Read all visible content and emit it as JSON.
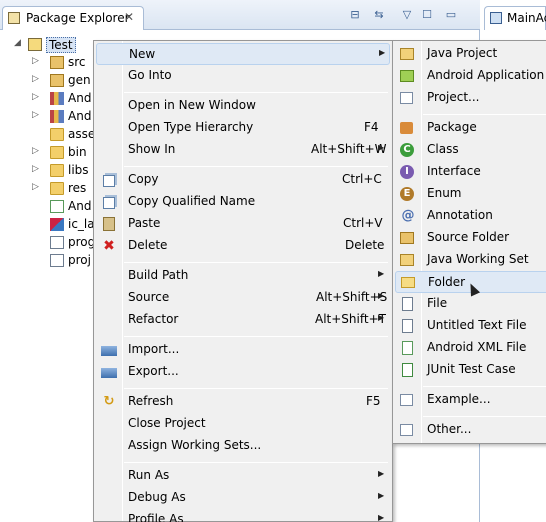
{
  "view": {
    "tab_title": "Package Explorer",
    "tab_close": "✕",
    "tools": [
      "⊟",
      "⇆",
      "▽",
      "☐"
    ],
    "editor_tab_title": "MainAc"
  },
  "tree": {
    "project": "Test",
    "items": [
      {
        "label": "src"
      },
      {
        "label": "gen"
      },
      {
        "label": "And"
      },
      {
        "label": "And"
      },
      {
        "label": "asse"
      },
      {
        "label": "bin"
      },
      {
        "label": "libs"
      },
      {
        "label": "res"
      },
      {
        "label": "And"
      },
      {
        "label": "ic_la"
      },
      {
        "label": "prog"
      },
      {
        "label": "proj"
      }
    ]
  },
  "context_menu": {
    "items": [
      {
        "label": "New",
        "accel": "",
        "submenu": true,
        "icon": ""
      },
      {
        "label": "Go Into",
        "accel": "",
        "submenu": false,
        "icon": ""
      },
      {
        "label": "Open in New Window",
        "accel": "",
        "submenu": false,
        "icon": ""
      },
      {
        "label": "Open Type Hierarchy",
        "accel": "F4",
        "submenu": false,
        "icon": ""
      },
      {
        "label": "Show In",
        "accel": "Alt+Shift+W",
        "submenu": true,
        "icon": ""
      },
      {
        "label": "Copy",
        "accel": "Ctrl+C",
        "submenu": false,
        "icon": "copy-icon"
      },
      {
        "label": "Copy Qualified Name",
        "accel": "",
        "submenu": false,
        "icon": "copy-icon"
      },
      {
        "label": "Paste",
        "accel": "Ctrl+V",
        "submenu": false,
        "icon": "paste-icon"
      },
      {
        "label": "Delete",
        "accel": "Delete",
        "submenu": false,
        "icon": "delete-icon"
      },
      {
        "label": "Build Path",
        "accel": "",
        "submenu": true,
        "icon": ""
      },
      {
        "label": "Source",
        "accel": "Alt+Shift+S",
        "submenu": true,
        "icon": ""
      },
      {
        "label": "Refactor",
        "accel": "Alt+Shift+T",
        "submenu": true,
        "icon": ""
      },
      {
        "label": "Import...",
        "accel": "",
        "submenu": false,
        "icon": "import-icon"
      },
      {
        "label": "Export...",
        "accel": "",
        "submenu": false,
        "icon": "export-icon"
      },
      {
        "label": "Refresh",
        "accel": "F5",
        "submenu": false,
        "icon": "refresh-icon"
      },
      {
        "label": "Close Project",
        "accel": "",
        "submenu": false,
        "icon": ""
      },
      {
        "label": "Assign Working Sets...",
        "accel": "",
        "submenu": false,
        "icon": ""
      },
      {
        "label": "Run As",
        "accel": "",
        "submenu": true,
        "icon": ""
      },
      {
        "label": "Debug As",
        "accel": "",
        "submenu": true,
        "icon": ""
      },
      {
        "label": "Profile As",
        "accel": "",
        "submenu": true,
        "icon": ""
      }
    ]
  },
  "new_submenu": {
    "items": [
      {
        "label": "Java Project",
        "icon": "java-project-icon"
      },
      {
        "label": "Android Application Pr",
        "icon": "android-project-icon"
      },
      {
        "label": "Project...",
        "icon": "project-icon"
      },
      {
        "label": "Package",
        "icon": "package-icon"
      },
      {
        "label": "Class",
        "icon": "class-icon",
        "glyph": "C"
      },
      {
        "label": "Interface",
        "icon": "interface-icon",
        "glyph": "I"
      },
      {
        "label": "Enum",
        "icon": "enum-icon",
        "glyph": "E"
      },
      {
        "label": "Annotation",
        "icon": "annotation-icon",
        "glyph": "@"
      },
      {
        "label": "Source Folder",
        "icon": "source-folder-icon"
      },
      {
        "label": "Java Working Set",
        "icon": "working-set-icon"
      },
      {
        "label": "Folder",
        "icon": "folder-icon"
      },
      {
        "label": "File",
        "icon": "file-icon"
      },
      {
        "label": "Untitled Text File",
        "icon": "text-file-icon"
      },
      {
        "label": "Android XML File",
        "icon": "android-xml-icon"
      },
      {
        "label": "JUnit Test Case",
        "icon": "junit-icon"
      },
      {
        "label": "Example...",
        "icon": "example-icon"
      },
      {
        "label": "Other...",
        "icon": "other-icon"
      }
    ]
  },
  "colors": {
    "menu_bg": "#f0f0f0",
    "hover_bg": "#dfe9f5",
    "hover_border": "#b9d2ee",
    "header_bg": "#dbe5f2"
  }
}
